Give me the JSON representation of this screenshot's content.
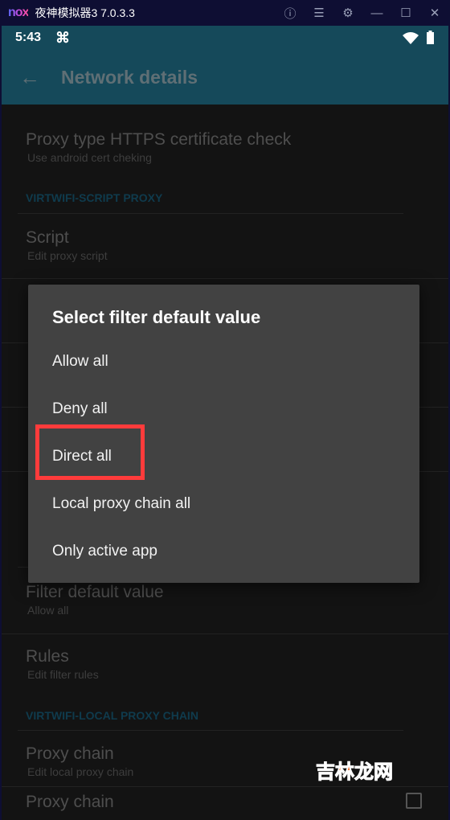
{
  "window": {
    "logo": "nox",
    "title": "夜神模拟器3 7.0.3.3",
    "icons": [
      "help-icon",
      "menu-icon",
      "gear-icon",
      "minimize-icon",
      "maximize-icon",
      "close-icon"
    ]
  },
  "status": {
    "time": "5:43",
    "notification_icon": "command-icon",
    "wifi_icon": "wifi-icon",
    "battery_icon": "battery-icon"
  },
  "toolbar": {
    "title": "Network details",
    "back_icon": "arrow-left-icon"
  },
  "list": {
    "proxy_type": {
      "title": "Proxy type HTTPS certificate check",
      "subtitle": "Use android cert cheking"
    },
    "section_script": "VIRTWIFI-SCRIPT PROXY",
    "script": {
      "title": "Script",
      "subtitle": "Edit proxy script"
    },
    "filter_default": {
      "title": "Filter default value",
      "subtitle": "Allow all"
    },
    "rules": {
      "title": "Rules",
      "subtitle": "Edit filter rules"
    },
    "section_chain": "VIRTWIFI-LOCAL PROXY CHAIN",
    "proxy_chain": {
      "title": "Proxy chain",
      "subtitle": "Edit local proxy chain"
    },
    "proxy_chain2": {
      "title": "Proxy chain"
    }
  },
  "dialog": {
    "title": "Select filter default value",
    "options": [
      "Allow all",
      "Deny all",
      "Direct all",
      "Local proxy chain all",
      "Only active app"
    ],
    "highlighted": "Direct all",
    "highlight_color": "#ff3b3b"
  },
  "watermark": {
    "text": "吉林龙网"
  }
}
